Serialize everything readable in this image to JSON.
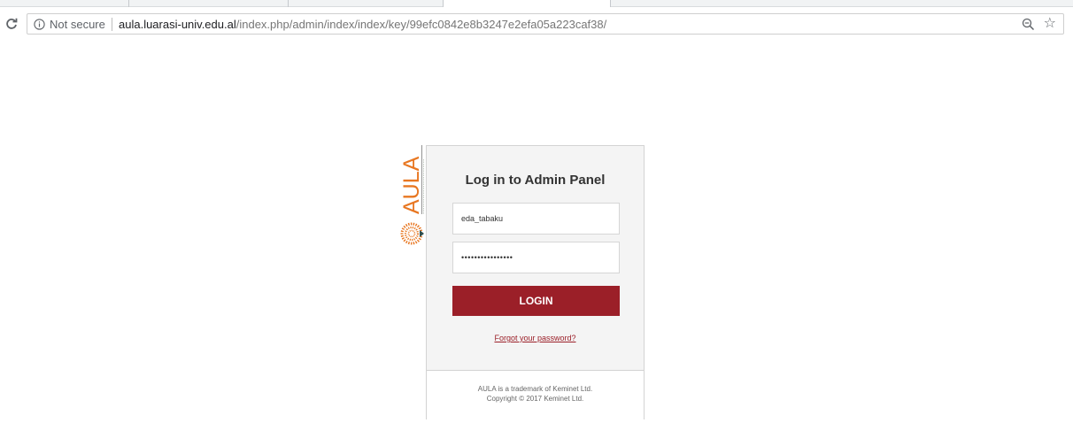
{
  "browser": {
    "security_label": "Not secure",
    "url_host": "aula.luarasi-univ.edu.al",
    "url_path": "/index.php/admin/index/index/key/99efc0842e8b3247e2efa05a223caf38/"
  },
  "logo": {
    "text": "AULA",
    "brand_color": "#e87722"
  },
  "login": {
    "title": "Log in to Admin Panel",
    "username_value": "eda_tabaku",
    "password_value": "••••••••••••••••",
    "button_label": "LOGIN",
    "forgot_link": "Forgot your password?",
    "accent_color": "#9b1f28"
  },
  "footer": {
    "line1": "AULA is a trademark of Keminet Ltd.",
    "line2": "Copyright © 2017 Keminet Ltd."
  }
}
